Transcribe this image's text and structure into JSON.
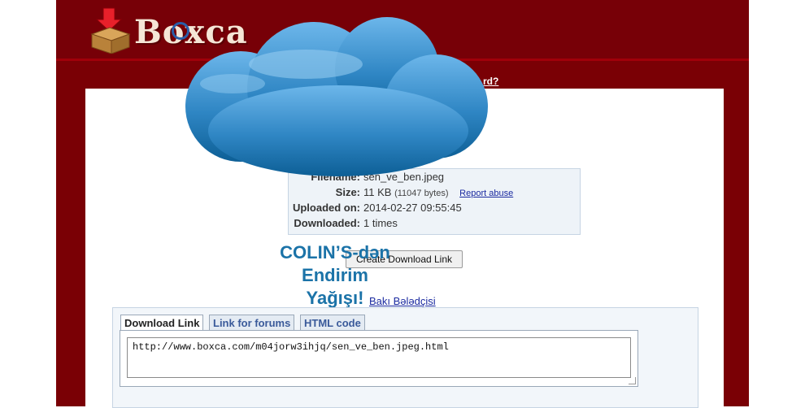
{
  "header": {
    "logo_text": "Boxca",
    "nav_link_fragment": "rd?"
  },
  "file_info": {
    "filename_label": "Filename:",
    "filename_value": "sen_ve_ben.jpeg",
    "size_label": "Size:",
    "size_value": "11 KB",
    "size_bytes": "(11047 bytes)",
    "report_abuse": "Report abuse",
    "uploaded_label": "Uploaded on:",
    "uploaded_value": "2014-02-27 09:55:45",
    "downloaded_label": "Downloaded:",
    "downloaded_value": "1 times"
  },
  "create_button_label": "Create Download Link",
  "ad": {
    "line1": "COLIN’S-dən",
    "line2": "Endirim",
    "line3": "Yağışı!",
    "link_text": "Bakı Bələdçisi"
  },
  "tabs": [
    {
      "label": "Download Link",
      "active": true
    },
    {
      "label": "Link for forums",
      "active": false
    },
    {
      "label": "HTML code",
      "active": false
    }
  ],
  "link_code": "http://www.boxca.com/m04jorw3ihjq/sen_ve_ben.jpeg.html",
  "colors": {
    "frame": "#7a0005",
    "header": "#770007",
    "panel": "#ffffff",
    "ad_text": "#1b73a8",
    "cloud_top": "#5aa6df",
    "cloud_bottom": "#0e6aa0"
  }
}
